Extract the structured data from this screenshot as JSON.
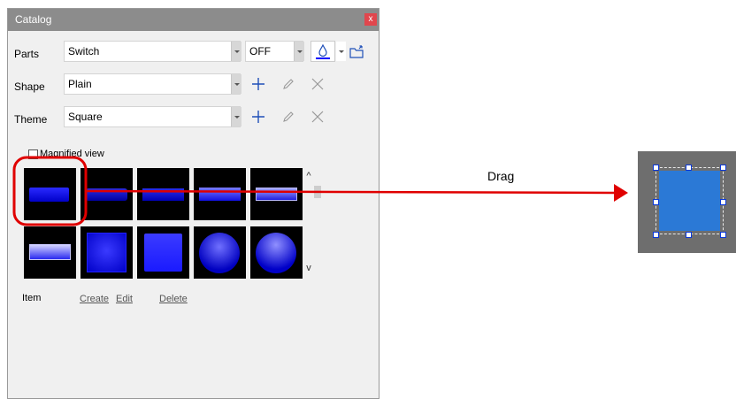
{
  "window": {
    "title": "Catalog",
    "close_label": "x"
  },
  "rows": {
    "parts": {
      "label": "Parts",
      "value": "Switch",
      "state_value": "OFF"
    },
    "shape": {
      "label": "Shape",
      "value": "Plain"
    },
    "theme": {
      "label": "Theme",
      "value": "Square"
    }
  },
  "options": {
    "magnified_label": "Magnified view"
  },
  "gallery": {
    "scroll_up": "^",
    "scroll_down": "v",
    "items": [
      {
        "kind": "bar"
      },
      {
        "kind": "bar"
      },
      {
        "kind": "bar"
      },
      {
        "kind": "bar"
      },
      {
        "kind": "bar"
      },
      {
        "kind": "bar"
      },
      {
        "kind": "square"
      },
      {
        "kind": "square"
      },
      {
        "kind": "circle"
      },
      {
        "kind": "circle"
      }
    ]
  },
  "footer": {
    "item_label": "Item",
    "create_label": "Create",
    "edit_label": "Edit",
    "delete_label": "Delete"
  },
  "annotation": {
    "drag_label": "Drag"
  },
  "colors": {
    "arrow": "#e00000",
    "shape_fill": "#2b79d6",
    "titlebar": "#8c8c8c",
    "close": "#e1464d"
  }
}
